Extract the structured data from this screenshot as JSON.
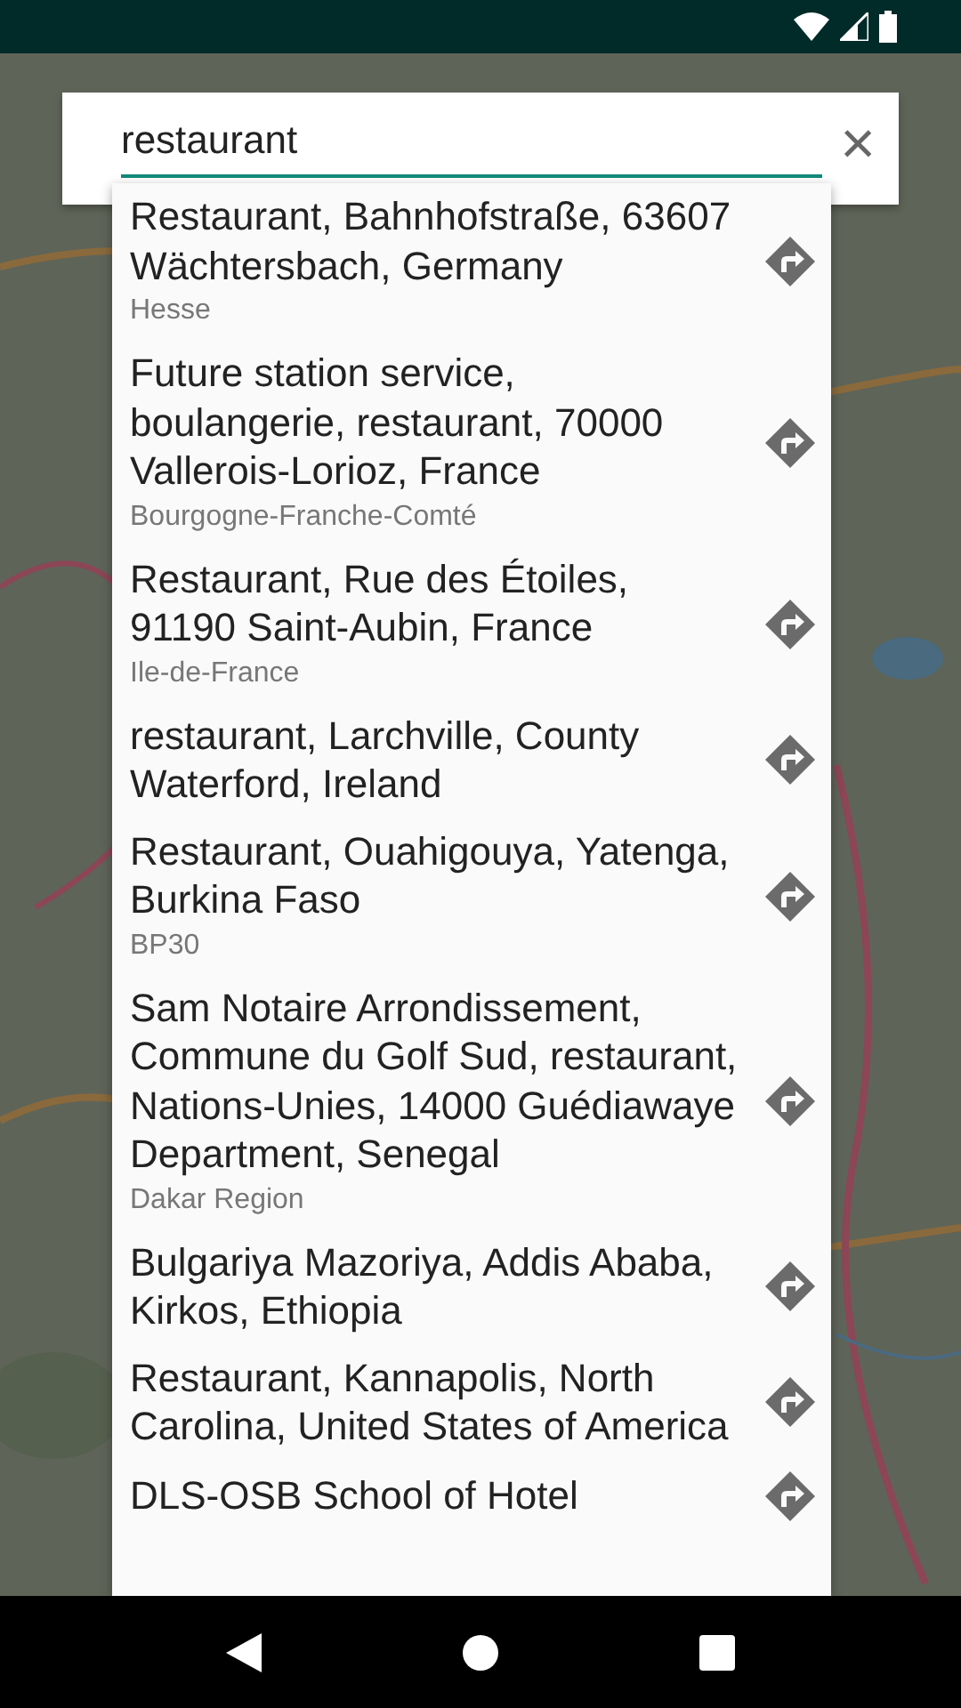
{
  "search": {
    "value": "restaurant",
    "clear_icon": "×"
  },
  "results": [
    {
      "title": "Restaurant, Bahnhofstraße, 63607 Wächtersbach, Germany",
      "subtitle": "Hesse"
    },
    {
      "title": "Future station service, boulangerie, restaurant, 70000 Vallerois-Lorioz, France",
      "subtitle": "Bourgogne-Franche-Comté"
    },
    {
      "title": "Restaurant, Rue des Étoiles, 91190 Saint-Aubin, France",
      "subtitle": "Ile-de-France"
    },
    {
      "title": "restaurant, Larchville, County Waterford, Ireland"
    },
    {
      "title": "Restaurant, Ouahigouya, Yatenga, Burkina Faso",
      "subtitle": "BP30"
    },
    {
      "title": "Sam Notaire Arrondissement, Commune du Golf Sud, restaurant, Nations-Unies, 14000 Guédiawaye Department, Senegal",
      "subtitle": "Dakar Region"
    },
    {
      "title": "Bulgariya Mazoriya, Addis Ababa, Kirkos, Ethiopia"
    },
    {
      "title": "Restaurant, Kannapolis, North Carolina, United States of America"
    },
    {
      "title": "DLS-OSB School of Hotel"
    }
  ]
}
